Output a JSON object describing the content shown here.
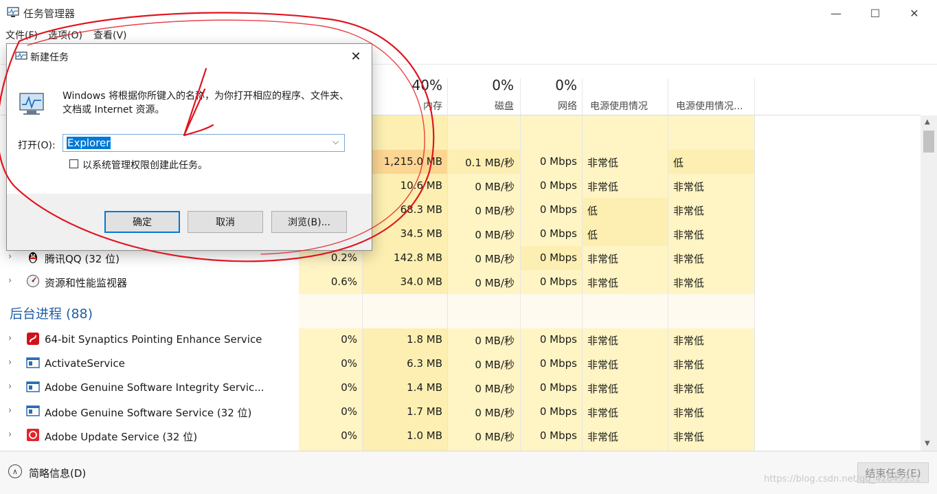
{
  "window": {
    "title": "任务管理器",
    "controls": {
      "minimize": "—",
      "maximize": "☐",
      "close": "✕"
    }
  },
  "menu": [
    "文件(F)",
    "选项(O)",
    "查看(V)"
  ],
  "columns": [
    {
      "pct": "40%",
      "label": "内存"
    },
    {
      "pct": "0%",
      "label": "磁盘"
    },
    {
      "pct": "0%",
      "label": "网络"
    },
    {
      "pct": "",
      "label": "电源使用情况"
    },
    {
      "pct": "",
      "label": "电源使用情况..."
    }
  ],
  "app_rows": [
    {
      "name": "",
      "cpu": "",
      "mem": "1,215.0 MB",
      "disk": "0.1 MB/秒",
      "net": "0 Mbps",
      "power": "非常低",
      "trend": "低"
    },
    {
      "name": "",
      "cpu": "",
      "mem": "10.6 MB",
      "disk": "0 MB/秒",
      "net": "0 Mbps",
      "power": "非常低",
      "trend": "非常低"
    },
    {
      "name": "",
      "cpu": "",
      "mem": "68.3 MB",
      "disk": "0 MB/秒",
      "net": "0 Mbps",
      "power": "低",
      "trend": "非常低"
    },
    {
      "name": "",
      "cpu": "",
      "mem": "34.5 MB",
      "disk": "0 MB/秒",
      "net": "0 Mbps",
      "power": "低",
      "trend": "非常低"
    },
    {
      "name": "腾讯QQ (32 位)",
      "cpu": "0.2%",
      "mem": "142.8 MB",
      "disk": "0 MB/秒",
      "net": "0 Mbps",
      "power": "非常低",
      "trend": "非常低",
      "icon": "qq-penguin-icon"
    },
    {
      "name": "资源和性能监视器",
      "cpu": "0.6%",
      "mem": "34.0 MB",
      "disk": "0 MB/秒",
      "net": "0 Mbps",
      "power": "非常低",
      "trend": "非常低",
      "icon": "resource-monitor-icon"
    }
  ],
  "background_section": "后台进程 (88)",
  "bg_rows": [
    {
      "name": "64-bit Synaptics Pointing Enhance Service",
      "cpu": "0%",
      "mem": "1.8 MB",
      "disk": "0 MB/秒",
      "net": "0 Mbps",
      "power": "非常低",
      "trend": "非常低",
      "icon": "synaptics-icon"
    },
    {
      "name": "ActivateService",
      "cpu": "0%",
      "mem": "6.3 MB",
      "disk": "0 MB/秒",
      "net": "0 Mbps",
      "power": "非常低",
      "trend": "非常低",
      "icon": "service-window-icon"
    },
    {
      "name": "Adobe Genuine Software Integrity Servic...",
      "cpu": "0%",
      "mem": "1.4 MB",
      "disk": "0 MB/秒",
      "net": "0 Mbps",
      "power": "非常低",
      "trend": "非常低",
      "icon": "service-window-icon"
    },
    {
      "name": "Adobe Genuine Software Service (32 位)",
      "cpu": "0%",
      "mem": "1.7 MB",
      "disk": "0 MB/秒",
      "net": "0 Mbps",
      "power": "非常低",
      "trend": "非常低",
      "icon": "service-window-icon"
    },
    {
      "name": "Adobe Update Service (32 位)",
      "cpu": "0%",
      "mem": "1.0 MB",
      "disk": "0 MB/秒",
      "net": "0 Mbps",
      "power": "非常低",
      "trend": "非常低",
      "icon": "adobe-icon"
    }
  ],
  "footer": {
    "brief_label": "简略信息(D)",
    "end_task": "结束任务(E)",
    "watermark": "https://blog.csdn.net/qq_42849331"
  },
  "dialog": {
    "title": "新建任务",
    "description": "Windows 将根据你所键入的名称，为你打开相应的程序、文件夹、文档或 Internet 资源。",
    "open_label": "打开(O):",
    "open_value": "Explorer",
    "admin_checkbox_label": "以系统管理权限创建此任务。",
    "admin_checked": false,
    "ok": "确定",
    "cancel": "取消",
    "browse": "浏览(B)..."
  },
  "colors": {
    "heat_light": "#fff4c4",
    "heat_mid": "#fcefb1",
    "heat_strong": "#f9e394",
    "heat_orange": "#fcd692",
    "annotation_red": "#e0141e",
    "accent_blue": "#0078d7",
    "section_blue": "#1f5fa8"
  }
}
